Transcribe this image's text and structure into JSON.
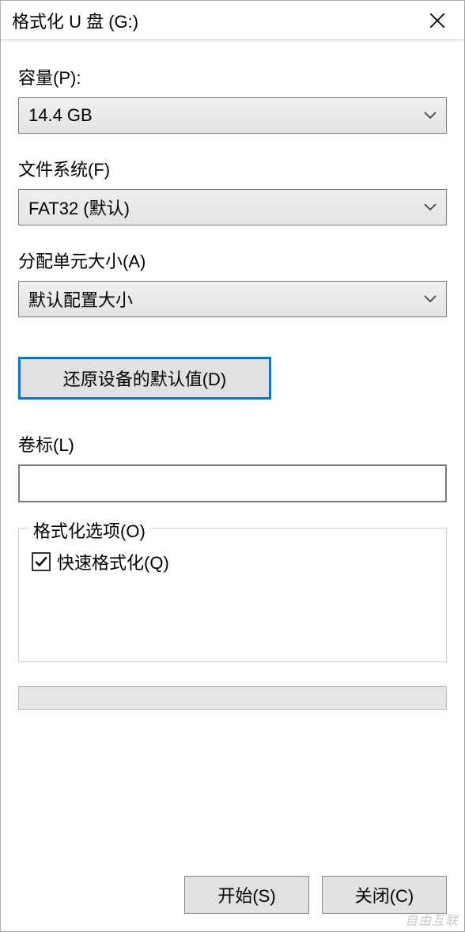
{
  "window": {
    "title": "格式化 U 盘 (G:)"
  },
  "capacity": {
    "label": "容量(P):",
    "value": "14.4 GB"
  },
  "filesystem": {
    "label": "文件系统(F)",
    "value": "FAT32 (默认)"
  },
  "allocation": {
    "label": "分配单元大小(A)",
    "value": "默认配置大小"
  },
  "restore": {
    "label": "还原设备的默认值(D)"
  },
  "volume": {
    "label": "卷标(L)",
    "value": ""
  },
  "options": {
    "legend": "格式化选项(O)",
    "quick_format": {
      "label": "快速格式化(Q)",
      "checked": true
    }
  },
  "buttons": {
    "start": "开始(S)",
    "close": "关闭(C)"
  },
  "watermark": "自由互联"
}
